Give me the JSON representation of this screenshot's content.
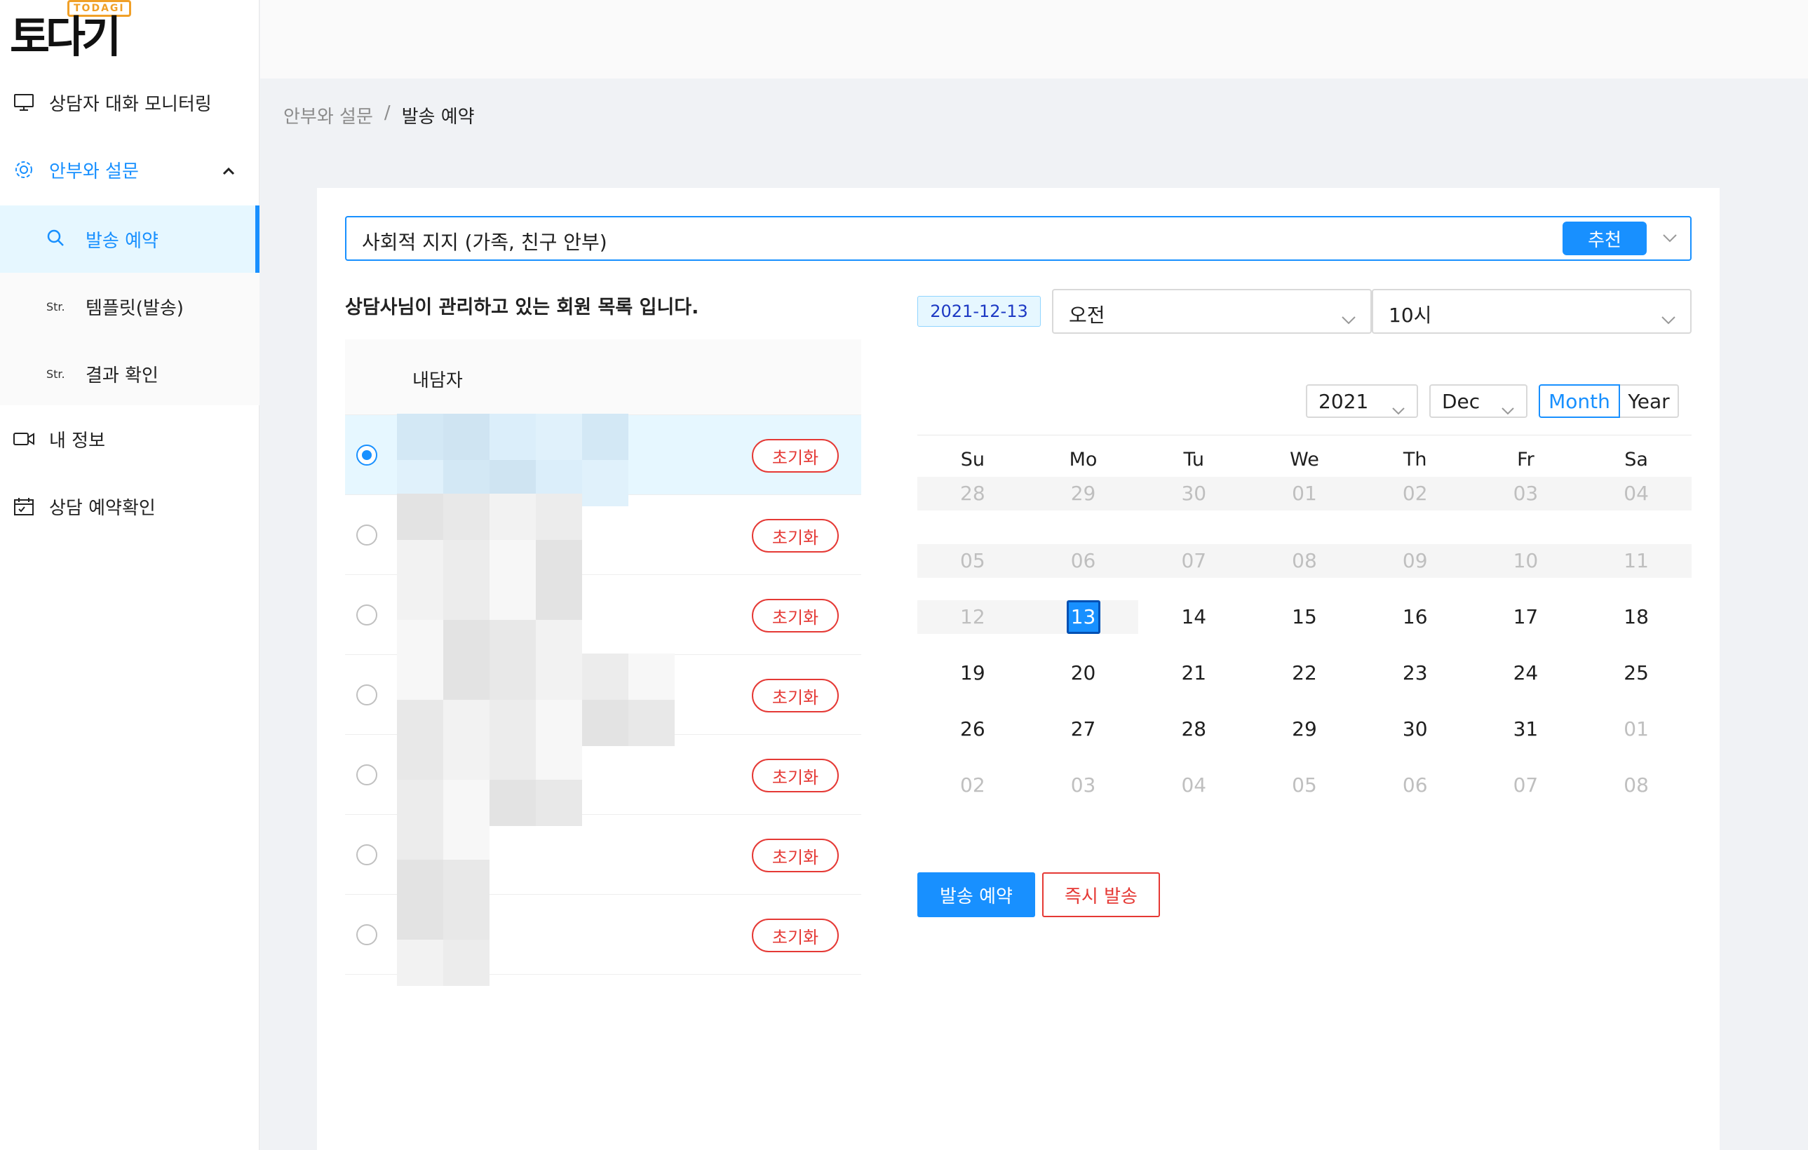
{
  "logo": {
    "text": "토다기",
    "tag": "TODAGI"
  },
  "sidebar": {
    "items": [
      {
        "label": "상담자 대화 모니터링",
        "icon": "monitor-icon"
      },
      {
        "label": "안부와 설문",
        "icon": "gear-icon"
      },
      {
        "label": "내 정보",
        "icon": "video-icon"
      },
      {
        "label": "상담 예약확인",
        "icon": "calendar-icon"
      }
    ],
    "submenu": [
      {
        "label": "발송 예약",
        "icon": "search-icon"
      },
      {
        "label": "템플릿(발송)",
        "icon_text": "Str."
      },
      {
        "label": "결과 확인",
        "icon_text": "Str."
      }
    ]
  },
  "breadcrumb": {
    "parent": "안부와 설문",
    "sep": "/",
    "current": "발송 예약"
  },
  "template_select": {
    "value": "사회적 지지 (가족, 친구 안부)",
    "recommend_label": "추천"
  },
  "members": {
    "title": "상담사님이 관리하고 있는 회원 목록 입니다.",
    "header": "내담자",
    "reset_label": "초기화",
    "selected_index": 0,
    "count": 7
  },
  "schedule": {
    "date": "2021-12-13",
    "ampm": "오전",
    "hour": "10시"
  },
  "calendar": {
    "year": "2021",
    "month": "Dec",
    "mode_month": "Month",
    "mode_year": "Year",
    "dow": [
      "Su",
      "Mo",
      "Tu",
      "We",
      "Th",
      "Fr",
      "Sa"
    ],
    "weeks": [
      [
        "28",
        "29",
        "30",
        "01",
        "02",
        "03",
        "04"
      ],
      [
        "05",
        "06",
        "07",
        "08",
        "09",
        "10",
        "11"
      ],
      [
        "12",
        "13",
        "14",
        "15",
        "16",
        "17",
        "18"
      ],
      [
        "19",
        "20",
        "21",
        "22",
        "23",
        "24",
        "25"
      ],
      [
        "26",
        "27",
        "28",
        "29",
        "30",
        "31",
        "01"
      ],
      [
        "02",
        "03",
        "04",
        "05",
        "06",
        "07",
        "08"
      ]
    ],
    "selected": "13"
  },
  "actions": {
    "schedule_label": "발송 예약",
    "send_now_label": "즉시 발송"
  }
}
